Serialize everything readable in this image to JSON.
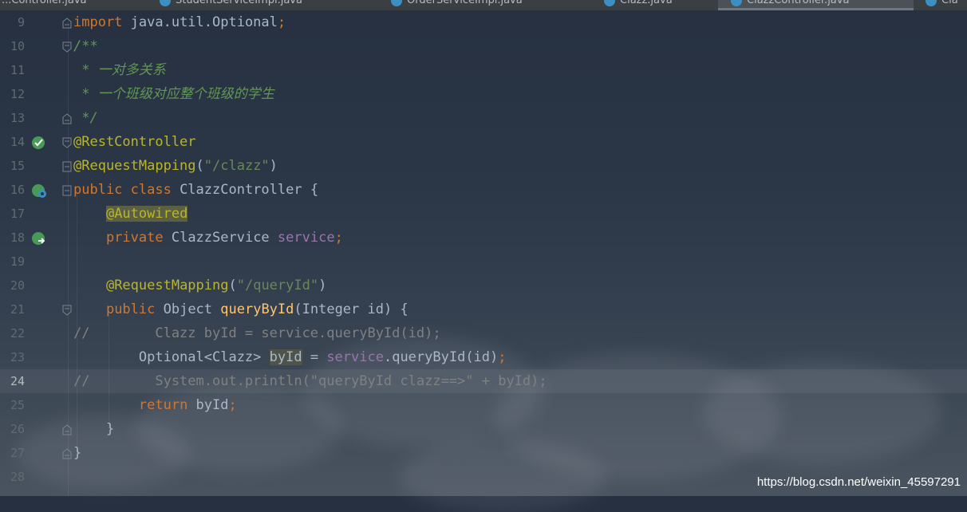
{
  "tabs": [
    {
      "label": "...Controller.java",
      "active": false
    },
    {
      "label": "StudentServiceImpl.java",
      "active": false
    },
    {
      "label": "OrderServiceImpl.java",
      "active": false
    },
    {
      "label": "Clazz.java",
      "active": false
    },
    {
      "label": "ClazzController.java",
      "active": true
    },
    {
      "label": "Cla",
      "active": false
    }
  ],
  "editor": {
    "current_line": "24",
    "lines": [
      {
        "num": "9",
        "tokens": [
          [
            "kw",
            "import "
          ],
          [
            "txt",
            "java.util.Optional"
          ],
          [
            "kw",
            ";"
          ]
        ]
      },
      {
        "num": "10",
        "tokens": [
          [
            "doc",
            "/**"
          ]
        ]
      },
      {
        "num": "11",
        "tokens": [
          [
            "doc",
            " * 一对多关系"
          ]
        ]
      },
      {
        "num": "12",
        "tokens": [
          [
            "doc",
            " * 一个班级对应整个班级的学生"
          ]
        ]
      },
      {
        "num": "13",
        "tokens": [
          [
            "doc",
            " */"
          ]
        ]
      },
      {
        "num": "14",
        "tokens": [
          [
            "ann",
            "@RestController"
          ]
        ]
      },
      {
        "num": "15",
        "tokens": [
          [
            "ann",
            "@RequestMapping"
          ],
          [
            "txt",
            "("
          ],
          [
            "str",
            "\"/clazz\""
          ],
          [
            "txt",
            ")"
          ]
        ]
      },
      {
        "num": "16",
        "tokens": [
          [
            "kw",
            "public class "
          ],
          [
            "txt",
            "ClazzController {"
          ]
        ]
      },
      {
        "num": "17",
        "tokens": [
          [
            "txt",
            "    "
          ],
          [
            "ann hl-ann",
            "@Autowired"
          ]
        ]
      },
      {
        "num": "18",
        "tokens": [
          [
            "txt",
            "    "
          ],
          [
            "kw",
            "private "
          ],
          [
            "txt",
            "ClazzService "
          ],
          [
            "fld",
            "service"
          ],
          [
            "kw",
            ";"
          ]
        ]
      },
      {
        "num": "19",
        "tokens": []
      },
      {
        "num": "20",
        "tokens": [
          [
            "txt",
            "    "
          ],
          [
            "ann",
            "@RequestMapping"
          ],
          [
            "txt",
            "("
          ],
          [
            "str",
            "\"/queryId\""
          ],
          [
            "txt",
            ")"
          ]
        ]
      },
      {
        "num": "21",
        "tokens": [
          [
            "txt",
            "    "
          ],
          [
            "kw",
            "public "
          ],
          [
            "txt",
            "Object "
          ],
          [
            "fn",
            "queryById"
          ],
          [
            "txt",
            "(Integer id) {"
          ]
        ]
      },
      {
        "num": "22",
        "tokens": [
          [
            "cmt",
            "//        Clazz byId = service.queryById(id);"
          ]
        ]
      },
      {
        "num": "23",
        "tokens": [
          [
            "txt",
            "        Optional<Clazz> "
          ],
          [
            "txt hl-var",
            "byId"
          ],
          [
            "txt",
            " = "
          ],
          [
            "fld",
            "service"
          ],
          [
            "txt",
            ".queryById(id)"
          ],
          [
            "kw",
            ";"
          ]
        ]
      },
      {
        "num": "24",
        "tokens": [
          [
            "cmt",
            "//        System.out.println(\"queryById clazz==>\" + byId);"
          ]
        ]
      },
      {
        "num": "25",
        "tokens": [
          [
            "txt",
            "        "
          ],
          [
            "kw",
            "return "
          ],
          [
            "txt",
            "byId"
          ],
          [
            "kw",
            ";"
          ]
        ]
      },
      {
        "num": "26",
        "tokens": [
          [
            "txt",
            "    }"
          ]
        ]
      },
      {
        "num": "27",
        "tokens": [
          [
            "txt",
            "}"
          ]
        ]
      },
      {
        "num": "28",
        "tokens": []
      }
    ]
  },
  "gutter_icons": {
    "14": "bean-check-icon",
    "16": "bean-class-icon",
    "18": "bean-autowired-icon"
  },
  "watermark": "https://blog.csdn.net/weixin_45597291",
  "colors": {
    "keyword": "#cc7832",
    "annotation": "#bbb529",
    "string": "#6a8759",
    "doc": "#629755",
    "comment": "#808080",
    "field": "#9876aa",
    "method": "#ffc66d"
  }
}
